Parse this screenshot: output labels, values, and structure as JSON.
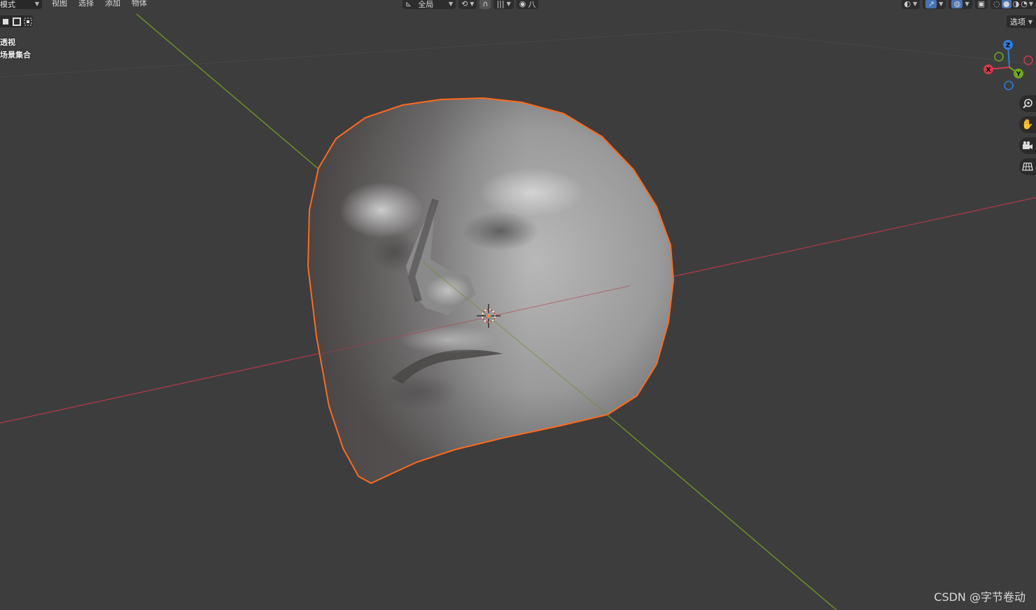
{
  "header": {
    "mode_label": "模式",
    "menu": [
      "视图",
      "选择",
      "添加",
      "物体"
    ],
    "transform_orientation": "全局",
    "snap_label": "|||",
    "falloff_label": "八"
  },
  "overlay_info": {
    "view_label": "透视",
    "collection_label": "场景集合"
  },
  "options_label": "选项",
  "gizmo": {
    "x": "X",
    "y": "Y",
    "z": "Z"
  },
  "nav_icons": [
    "zoom-icon",
    "hand-pan-icon",
    "camera-icon",
    "grid-ortho-icon"
  ],
  "colors": {
    "background": "#3d3d3d",
    "x_axis": "#b23a48",
    "y_axis": "#6b8f28",
    "z_axis": "#2b7ee0",
    "selection_outline": "#ff6a1f",
    "active_blue": "#4772b3"
  },
  "watermark": "CSDN @字节卷动"
}
